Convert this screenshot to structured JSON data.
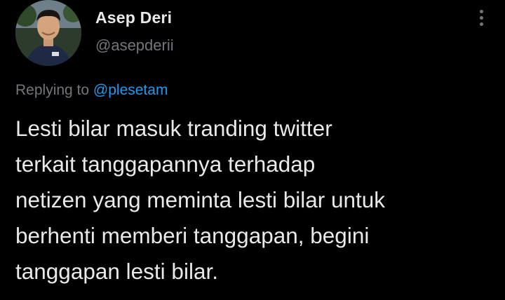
{
  "tweet": {
    "author": {
      "display_name": "Asep Deri",
      "handle": "@asepderii",
      "avatar_icon": "profile-photo"
    },
    "more_icon": "more-options-icon",
    "reply_context": {
      "prefix": "Replying to",
      "mention": "@plesetam"
    },
    "text_lines": [
      "Lesti bilar masuk tranding twitter",
      "terkait tanggapannya terhadap",
      "netizen yang meminta lesti bilar untuk",
      "berhenti memberi tanggapan, begini",
      "tanggapan lesti bilar."
    ]
  },
  "colors": {
    "background": "#000000",
    "primary_text": "#e7e9ea",
    "secondary_text": "#71767b",
    "link": "#1d9bf0"
  }
}
